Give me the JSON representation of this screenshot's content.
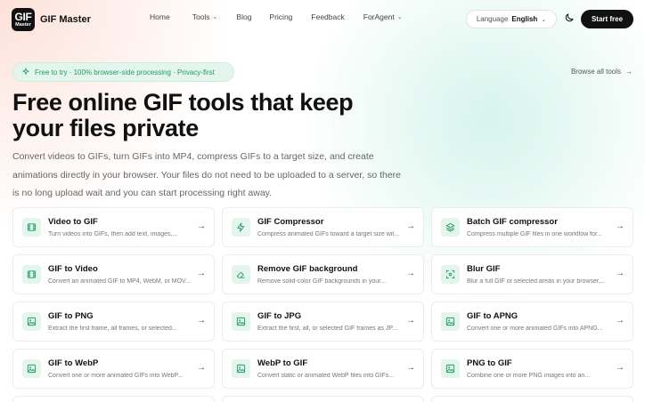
{
  "brand": {
    "logo_line1": "GIF",
    "logo_line2": "Master",
    "name": "GIF Master"
  },
  "nav": [
    {
      "label": "Home",
      "dropdown": false
    },
    {
      "label": "Tools",
      "dropdown": true
    },
    {
      "label": "Blog",
      "dropdown": false
    },
    {
      "label": "Pricing",
      "dropdown": false
    },
    {
      "label": "Feedback",
      "dropdown": false
    },
    {
      "label": "ForAgent",
      "dropdown": true
    }
  ],
  "language": {
    "label": "Language",
    "value": "English"
  },
  "header": {
    "start_label": "Start free"
  },
  "hero": {
    "badge": "Free to try · 100% browser-side processing · Privacy-first",
    "browse_label": "Browse all tools",
    "title": "Free online GIF tools that keep your files private",
    "subtitle": "Convert videos to GIFs, turn GIFs into MP4, compress GIFs to a target size, and create animations directly in your browser. Your files do not need to be uploaded to a server, so there is no long upload wait and you can start processing right away."
  },
  "colors": {
    "accent": "#1f9d63",
    "accent_bg": "#e3f5ec",
    "dark": "#111111"
  },
  "tools": [
    {
      "icon": "film-icon",
      "title": "Video to GIF",
      "desc": "Turn videos into GIFs, then add text, images,..."
    },
    {
      "icon": "bolt-icon",
      "title": "GIF Compressor",
      "desc": "Compress animated GIFs toward a target size wit..."
    },
    {
      "icon": "layers-icon",
      "title": "Batch GIF compressor",
      "desc": "Compress multiple GIF files in one workflow for..."
    },
    {
      "icon": "film-icon",
      "title": "GIF to Video",
      "desc": "Convert an animated GIF to MP4, WebM, or MOV..."
    },
    {
      "icon": "eraser-icon",
      "title": "Remove GIF background",
      "desc": "Remove solid-color GIF backgrounds in your..."
    },
    {
      "icon": "focus-icon",
      "title": "Blur GIF",
      "desc": "Blur a full GIF or selected areas in your browser,..."
    },
    {
      "icon": "image-icon",
      "title": "GIF to PNG",
      "desc": "Extract the first frame, all frames, or selected..."
    },
    {
      "icon": "image-icon",
      "title": "GIF to JPG",
      "desc": "Extract the first, all, or selected GIF frames as JP..."
    },
    {
      "icon": "image-icon",
      "title": "GIF to APNG",
      "desc": "Convert one or more animated GIFs into APNG..."
    },
    {
      "icon": "image-icon",
      "title": "GIF to WebP",
      "desc": "Convert one or more animated GIFs into WebP..."
    },
    {
      "icon": "image-icon",
      "title": "WebP to GIF",
      "desc": "Convert static or animated WebP files into GIFs..."
    },
    {
      "icon": "image-icon",
      "title": "PNG to GIF",
      "desc": "Combine one or more PNG images into an..."
    }
  ]
}
